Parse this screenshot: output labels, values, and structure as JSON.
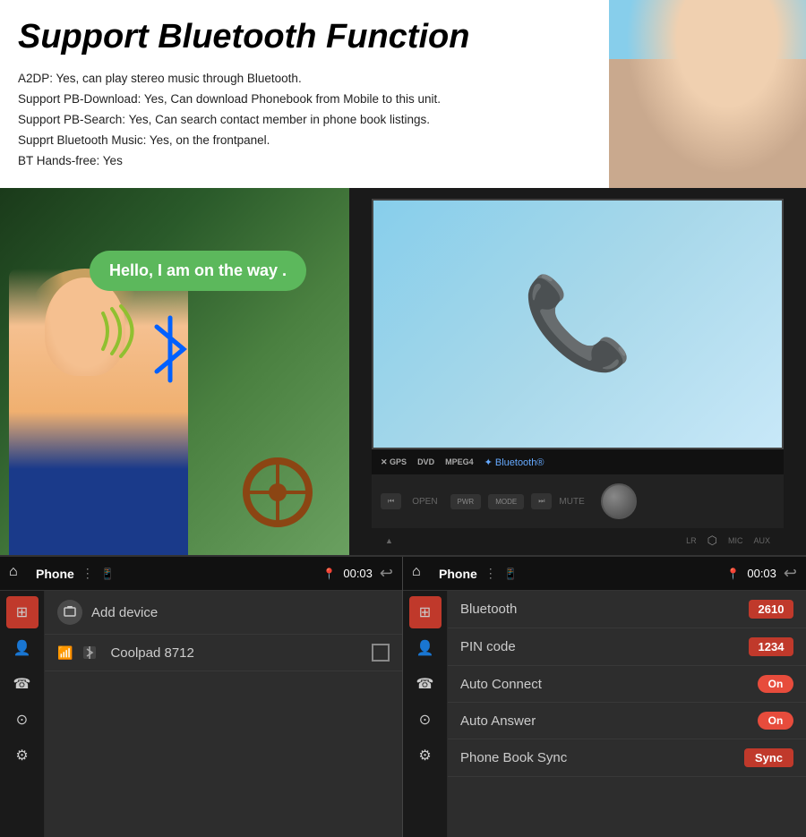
{
  "page": {
    "title": "Support Bluetooth Function",
    "features": [
      "A2DP: Yes, can play stereo music through Bluetooth.",
      "Support PB-Download: Yes, Can download Phonebook from Mobile to this unit.",
      "Support PB-Search: Yes, Can search contact member in phone book listings.",
      "Supprt Bluetooth Music: Yes, on the frontpanel.",
      "BT Hands-free: Yes"
    ],
    "hello_bubble": "Hello, I am on the way .",
    "device_logos": [
      "GPS",
      "DVD",
      "MPEG4",
      "Bluetooth®"
    ],
    "left_panel": {
      "topbar": {
        "app_label": "Phone",
        "time": "00:03"
      },
      "list_items": [
        {
          "label": "Add device",
          "type": "add"
        },
        {
          "label": "Coolpad 8712",
          "type": "device"
        }
      ]
    },
    "right_panel": {
      "topbar": {
        "app_label": "Phone",
        "time": "00:03"
      },
      "settings": [
        {
          "label": "Bluetooth",
          "value": "2610",
          "type": "badge"
        },
        {
          "label": "PIN code",
          "value": "1234",
          "type": "badge"
        },
        {
          "label": "Auto Connect",
          "value": "On",
          "type": "toggle"
        },
        {
          "label": "Auto Answer",
          "value": "On",
          "type": "toggle"
        },
        {
          "label": "Phone Book Sync",
          "value": "Sync",
          "type": "sync"
        }
      ]
    },
    "sidebar_icons": [
      {
        "name": "grid-icon",
        "symbol": "⊞",
        "active": true
      },
      {
        "name": "contacts-icon",
        "symbol": "👤"
      },
      {
        "name": "dialpad-icon",
        "symbol": "☎"
      },
      {
        "name": "lock-icon",
        "symbol": "⊙"
      },
      {
        "name": "settings-icon",
        "symbol": "⚙"
      }
    ]
  }
}
